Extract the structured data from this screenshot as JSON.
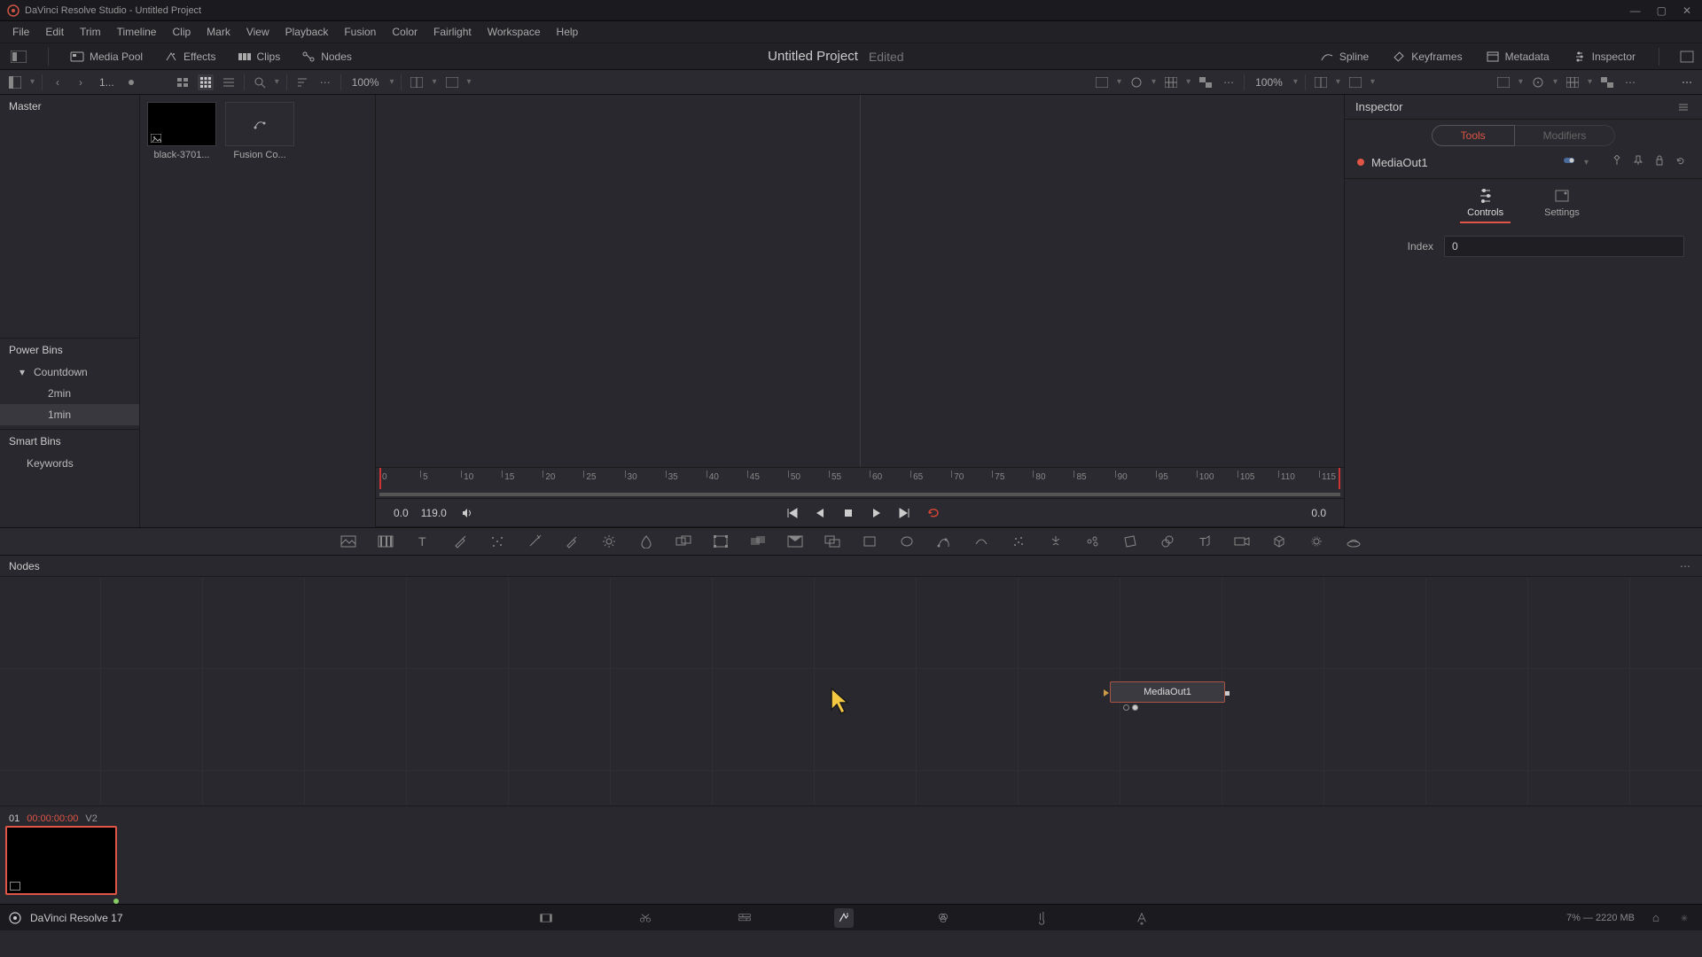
{
  "app": {
    "title": "DaVinci Resolve Studio - Untitled Project"
  },
  "window": {
    "min": "—",
    "max": "▢",
    "close": "✕"
  },
  "menu": [
    "File",
    "Edit",
    "Trim",
    "Timeline",
    "Clip",
    "Mark",
    "View",
    "Playback",
    "Fusion",
    "Color",
    "Fairlight",
    "Workspace",
    "Help"
  ],
  "shelf": {
    "media_pool": "Media Pool",
    "effects": "Effects",
    "clips": "Clips",
    "nodes": "Nodes",
    "project": "Untitled Project",
    "status": "Edited",
    "spline": "Spline",
    "keyframes": "Keyframes",
    "metadata": "Metadata",
    "inspector": "Inspector"
  },
  "secondary": {
    "nav_label": "1...",
    "zoom_left": "100%",
    "zoom_right": "100%"
  },
  "pool": {
    "master": "Master",
    "power_bins": "Power Bins",
    "countdown": "Countdown",
    "two_min": "2min",
    "one_min": "1min",
    "smart_bins": "Smart Bins",
    "keywords": "Keywords"
  },
  "clips": {
    "c1": "black-3701...",
    "c2": "Fusion Co..."
  },
  "ruler": {
    "ticks": [
      "0",
      "5",
      "10",
      "15",
      "20",
      "25",
      "30",
      "35",
      "40",
      "45",
      "50",
      "55",
      "60",
      "65",
      "70",
      "75",
      "80",
      "85",
      "90",
      "95",
      "100",
      "105",
      "110",
      "115"
    ]
  },
  "transport": {
    "start": "0.0",
    "dur": "119.0",
    "end": "0.0"
  },
  "inspector": {
    "title": "Inspector",
    "tab_tools": "Tools",
    "tab_modifiers": "Modifiers",
    "node": "MediaOut1",
    "sub_controls": "Controls",
    "sub_settings": "Settings",
    "prop_index": "Index",
    "prop_index_val": "0"
  },
  "nodes_panel": {
    "title": "Nodes",
    "media_out": "MediaOut1"
  },
  "clipstrip": {
    "idx": "01",
    "tc": "00:00:00:00",
    "track": "V2"
  },
  "footer": {
    "app": "DaVinci Resolve 17",
    "gpu": "7% — 2220 MB"
  }
}
